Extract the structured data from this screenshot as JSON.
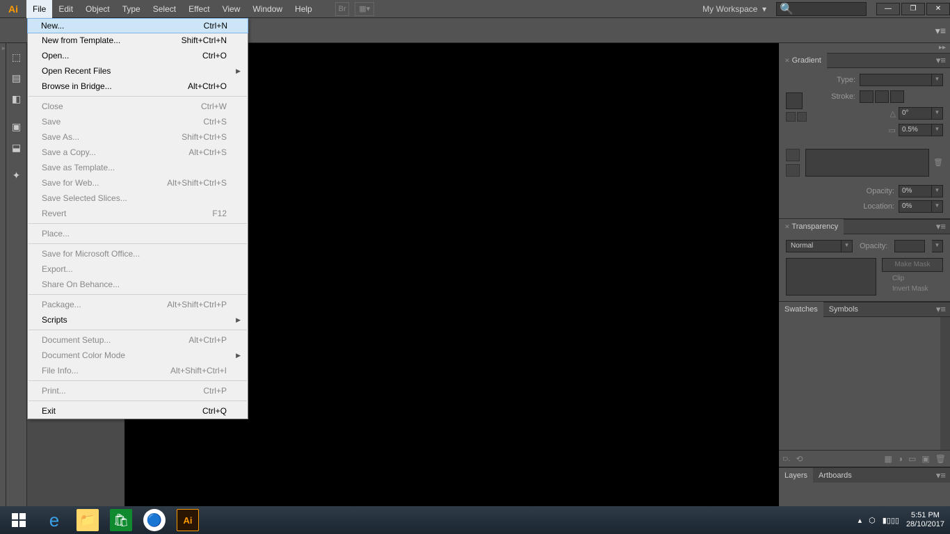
{
  "menubar": {
    "logo": "Ai",
    "items": [
      "File",
      "Edit",
      "Object",
      "Type",
      "Select",
      "Effect",
      "View",
      "Window",
      "Help"
    ],
    "active_index": 0,
    "workspace": "My Workspace",
    "search_placeholder": ""
  },
  "file_menu": {
    "groups": [
      [
        {
          "label": "New...",
          "shortcut": "Ctrl+N",
          "hl": true
        },
        {
          "label": "New from Template...",
          "shortcut": "Shift+Ctrl+N"
        },
        {
          "label": "Open...",
          "shortcut": "Ctrl+O"
        },
        {
          "label": "Open Recent Files",
          "submenu": true
        },
        {
          "label": "Browse in Bridge...",
          "shortcut": "Alt+Ctrl+O"
        }
      ],
      [
        {
          "label": "Close",
          "shortcut": "Ctrl+W",
          "disabled": true
        },
        {
          "label": "Save",
          "shortcut": "Ctrl+S",
          "disabled": true
        },
        {
          "label": "Save As...",
          "shortcut": "Shift+Ctrl+S",
          "disabled": true
        },
        {
          "label": "Save a Copy...",
          "shortcut": "Alt+Ctrl+S",
          "disabled": true
        },
        {
          "label": "Save as Template...",
          "disabled": true
        },
        {
          "label": "Save for Web...",
          "shortcut": "Alt+Shift+Ctrl+S",
          "disabled": true
        },
        {
          "label": "Save Selected Slices...",
          "disabled": true
        },
        {
          "label": "Revert",
          "shortcut": "F12",
          "disabled": true
        }
      ],
      [
        {
          "label": "Place...",
          "disabled": true
        }
      ],
      [
        {
          "label": "Save for Microsoft Office...",
          "disabled": true
        },
        {
          "label": "Export...",
          "disabled": true
        },
        {
          "label": "Share On Behance...",
          "disabled": true
        }
      ],
      [
        {
          "label": "Package...",
          "shortcut": "Alt+Shift+Ctrl+P",
          "disabled": true
        },
        {
          "label": "Scripts",
          "submenu": true
        }
      ],
      [
        {
          "label": "Document Setup...",
          "shortcut": "Alt+Ctrl+P",
          "disabled": true
        },
        {
          "label": "Document Color Mode",
          "submenu": true,
          "disabled": true
        },
        {
          "label": "File Info...",
          "shortcut": "Alt+Shift+Ctrl+I",
          "disabled": true
        }
      ],
      [
        {
          "label": "Print...",
          "shortcut": "Ctrl+P",
          "disabled": true
        }
      ],
      [
        {
          "label": "Exit",
          "shortcut": "Ctrl+Q"
        }
      ]
    ]
  },
  "panels": {
    "gradient": {
      "title": "Gradient",
      "labels": {
        "type": "Type:",
        "stroke": "Stroke:",
        "angle_icon": "△",
        "angle": "0°",
        "ratio_icon": "▭",
        "ratio": "0.5%",
        "opacity": "Opacity:",
        "opacity_val": "0%",
        "location": "Location:",
        "location_val": "0%"
      }
    },
    "transparency": {
      "title": "Transparency",
      "blend": "Normal",
      "opacity_label": "Opacity:",
      "opacity": "",
      "make_mask": "Make Mask",
      "clip": "Clip",
      "invert": "Invert Mask"
    },
    "swatches": {
      "tab1": "Swatches",
      "tab2": "Symbols"
    },
    "layers": {
      "tab1": "Layers",
      "tab2": "Artboards"
    }
  },
  "taskbar": {
    "time": "5:51 PM",
    "date": "28/10/2017"
  }
}
